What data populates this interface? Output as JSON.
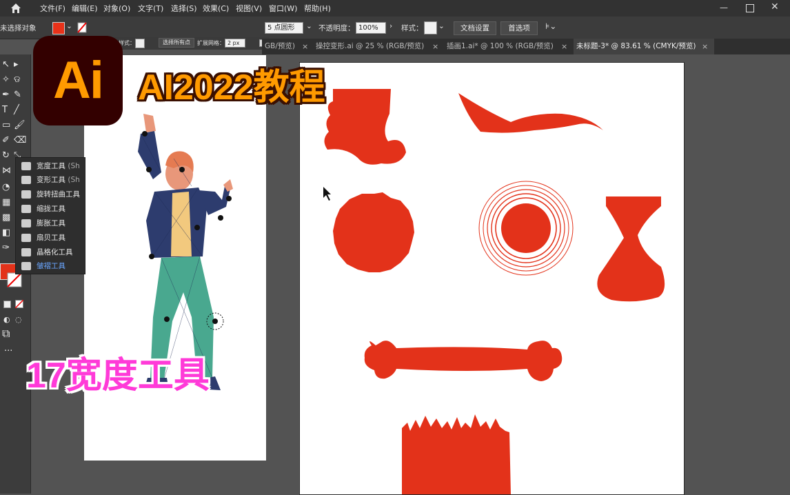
{
  "menu": {
    "items": [
      "文件(F)",
      "编辑(E)",
      "对象(O)",
      "文字(T)",
      "选择(S)",
      "效果(C)",
      "视图(V)",
      "窗口(W)",
      "帮助(H)"
    ]
  },
  "control_bar": {
    "selection_status": "未选择对象",
    "fill_color": "#e8321a",
    "brush_value": "5 点圆形",
    "opacity_label": "不透明度：",
    "opacity_value": "100%",
    "style_label": "样式：",
    "doc_setup_button": "文档设置",
    "prefs_button": "首选项"
  },
  "sub_control": {
    "style_label": "样式：",
    "select_all_button": "选择所有点",
    "expand_label": "扩展网格：",
    "expand_value": "2 px"
  },
  "tabs": [
    {
      "label": "GB/预览)",
      "active": false
    },
    {
      "label": "操控变形.ai @ 25 % (RGB/预览)",
      "active": false
    },
    {
      "label": "插画1.ai* @ 100 % (RGB/预览)",
      "active": false
    },
    {
      "label": "未标题-3* @ 83.61 % (CMYK/预览)",
      "active": true
    }
  ],
  "tab_close_symbol": "×",
  "flyout": {
    "items": [
      {
        "label": "宽度工具",
        "shortcut": "(Sh",
        "selected": false
      },
      {
        "label": "变形工具",
        "shortcut": "(Sh",
        "selected": false
      },
      {
        "label": "旋转扭曲工具",
        "shortcut": "",
        "selected": false
      },
      {
        "label": "缩拢工具",
        "shortcut": "",
        "selected": false
      },
      {
        "label": "膨胀工具",
        "shortcut": "",
        "selected": false
      },
      {
        "label": "扇贝工具",
        "shortcut": "",
        "selected": false
      },
      {
        "label": "晶格化工具",
        "shortcut": "",
        "selected": false
      },
      {
        "label": "皱褶工具",
        "shortcut": "",
        "selected": true
      }
    ]
  },
  "overlay": {
    "logo_text": "Ai",
    "title_text": "AI2022教程",
    "lesson_text": "17宽度工具"
  },
  "colors": {
    "shape_red": "#e3321a",
    "logo_bg": "#330000",
    "logo_fg": "#ff9a00",
    "lesson_color": "#ff3ad8"
  }
}
